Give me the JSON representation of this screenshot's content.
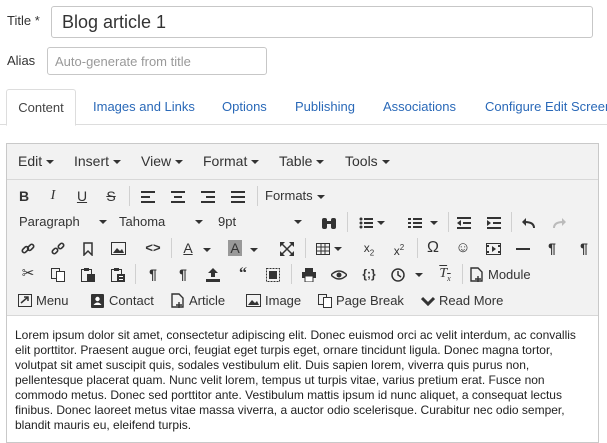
{
  "form": {
    "title_label": "Title *",
    "title_value": "Blog article 1",
    "alias_label": "Alias",
    "alias_placeholder": "Auto-generate from title"
  },
  "tabs": [
    {
      "label": "Content",
      "active": true
    },
    {
      "label": "Images and Links"
    },
    {
      "label": "Options"
    },
    {
      "label": "Publishing"
    },
    {
      "label": "Associations"
    },
    {
      "label": "Configure Edit Screen"
    }
  ],
  "menubar": [
    "Edit",
    "Insert",
    "View",
    "Format",
    "Table",
    "Tools"
  ],
  "toolbar": {
    "formats_label": "Formats",
    "block_format": "Paragraph",
    "font_family": "Tahoma",
    "font_size": "9pt",
    "module_label": "Module",
    "menu_label": "Menu",
    "contact_label": "Contact",
    "article_label": "Article",
    "image_label": "Image",
    "pagebreak_label": "Page Break",
    "readmore_label": "Read More"
  },
  "body_text": "Lorem ipsum dolor sit amet, consectetur adipiscing elit. Donec euismod orci ac velit interdum, ac convallis elit porttitor. Praesent augue orci, feugiat eget turpis eget, ornare tincidunt ligula. Donec magna tortor, volutpat sit amet suscipit quis, sodales vestibulum elit. Duis sapien lorem, viverra quis purus non, pellentesque placerat quam. Nunc velit lorem, tempus ut turpis vitae, varius pretium erat. Fusce non commodo metus. Donec sed porttitor ante. Vestibulum mattis ipsum id nunc aliquet, a consequat lectus finibus. Donec laoreet metus vitae massa viverra, a auctor odio scelerisque. Curabitur nec odio semper, blandit mauris eu, eleifend turpis."
}
